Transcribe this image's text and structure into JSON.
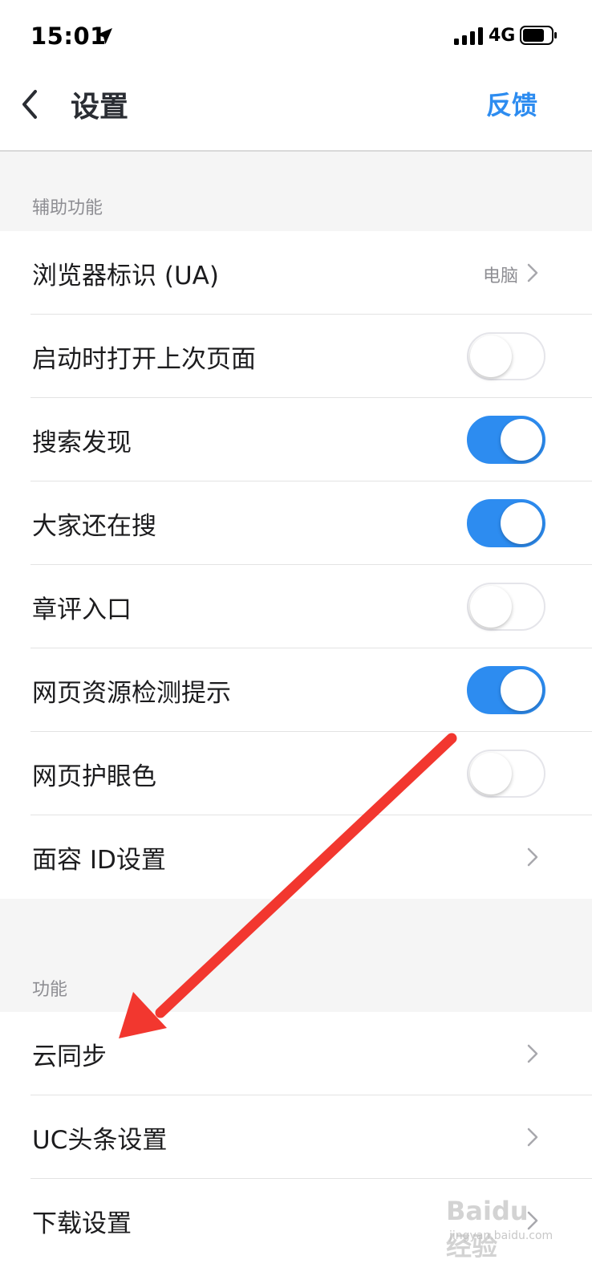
{
  "status_bar": {
    "time": "15:01",
    "network": "4G",
    "location_icon": "location-arrow-icon",
    "signal_icon": "cellular-signal-icon",
    "battery_icon": "battery-icon"
  },
  "nav": {
    "title": "设置",
    "back_icon": "chevron-left-icon",
    "feedback_label": "反馈",
    "accent_color": "#2d8cf0"
  },
  "sections": [
    {
      "header": "辅助功能",
      "rows": [
        {
          "label": "浏览器标识 (UA)",
          "type": "link",
          "value": "电脑"
        },
        {
          "label": "启动时打开上次页面",
          "type": "toggle",
          "on": false
        },
        {
          "label": "搜索发现",
          "type": "toggle",
          "on": true
        },
        {
          "label": "大家还在搜",
          "type": "toggle",
          "on": true
        },
        {
          "label": "章评入口",
          "type": "toggle",
          "on": false
        },
        {
          "label": "网页资源检测提示",
          "type": "toggle",
          "on": true
        },
        {
          "label": "网页护眼色",
          "type": "toggle",
          "on": false
        },
        {
          "label": "面容 ID设置",
          "type": "link"
        }
      ]
    },
    {
      "header": "功能",
      "rows": [
        {
          "label": "云同步",
          "type": "link"
        },
        {
          "label": "UC头条设置",
          "type": "link"
        },
        {
          "label": "下载设置",
          "type": "link"
        }
      ]
    }
  ],
  "annotation": {
    "arrow_color": "#f2372f",
    "arrow_icon": "red-arrow-annotation"
  },
  "watermark": {
    "brand": "Baidu经验",
    "sub": "jingyan.baidu.com"
  }
}
